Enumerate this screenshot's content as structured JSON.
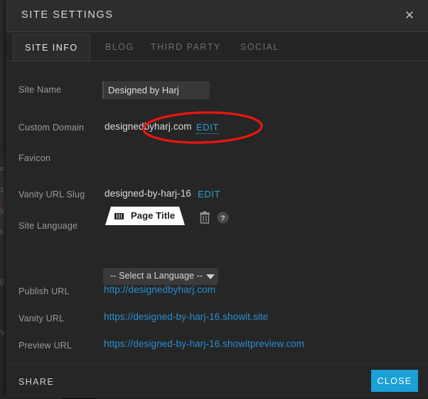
{
  "window": {
    "title": "SITE SETTINGS",
    "close_icon": "close-icon"
  },
  "tabs": [
    {
      "label": "SITE INFO",
      "active": true
    },
    {
      "label": "BLOG",
      "active": false
    },
    {
      "label": "THIRD PARTY",
      "active": false
    },
    {
      "label": "SOCIAL",
      "active": false
    }
  ],
  "form": {
    "site_name": {
      "label": "Site Name",
      "value": "Designed by Harj",
      "placeholder": ""
    },
    "custom_domain": {
      "label": "Custom Domain",
      "value": "designedbyharj.com",
      "edit_label": "EDIT"
    },
    "favicon": {
      "label": "Favicon",
      "tab_preview_title": "Page Title",
      "delete_icon": "trash-icon",
      "help_icon": "help-icon"
    },
    "vanity_slug": {
      "label": "Vanity URL Slug",
      "value": "designed-by-harj-16",
      "edit_label": "EDIT"
    },
    "site_language": {
      "label": "Site Language",
      "selected": "-- Select a Language --"
    }
  },
  "urls": [
    {
      "label": "Publish URL",
      "value": "http://designedbyharj.com"
    },
    {
      "label": "Vanity URL",
      "value": "https://designed-by-harj-16.showit.site"
    },
    {
      "label": "Preview URL",
      "value": "https://designed-by-harj-16.showitpreview.com"
    }
  ],
  "footer": {
    "share_label": "SHARE",
    "close_label": "CLOSE"
  },
  "colors": {
    "accent": "#1ba0d7",
    "link": "#2a8fd1",
    "annotation": "#e8170f",
    "panel": "#262626"
  },
  "annotation": {
    "shape": "ellipse",
    "target": "custom-domain-edit"
  }
}
